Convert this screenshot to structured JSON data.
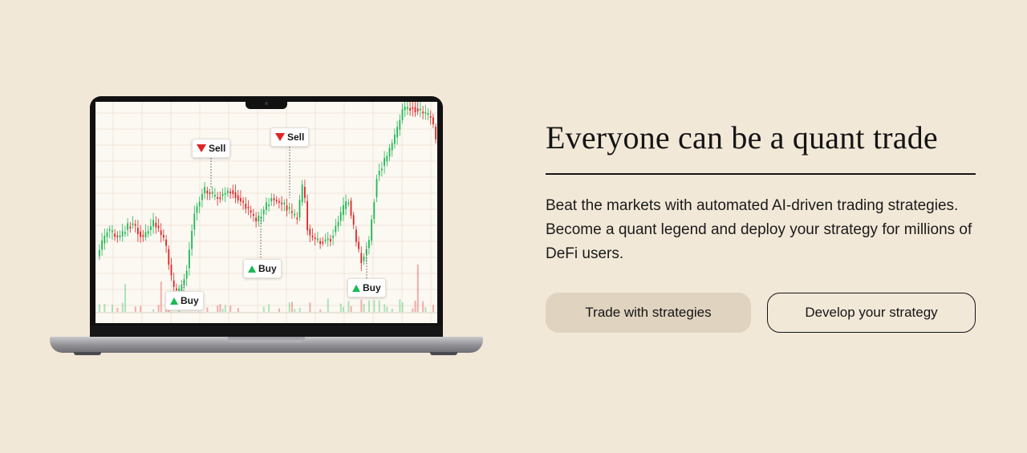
{
  "hero": {
    "title": "Everyone can be a quant trade",
    "description": "Beat the markets with automated AI-driven trading strategies. Become a quant legend and deploy your strategy for millions of DeFi users.",
    "buttons": {
      "primary_label": "Trade with strategies",
      "secondary_label": "Develop your strategy"
    }
  },
  "chart_data": {
    "type": "candlestick",
    "markers": [
      {
        "label": "Sell",
        "direction": "down",
        "color": "#e02424"
      },
      {
        "label": "Sell",
        "direction": "down",
        "color": "#e02424"
      },
      {
        "label": "Buy",
        "direction": "up",
        "color": "#1db954"
      },
      {
        "label": "Buy",
        "direction": "up",
        "color": "#1db954"
      },
      {
        "label": "Buy",
        "direction": "up",
        "color": "#1db954"
      }
    ],
    "colors": {
      "up": "#1db954",
      "down": "#e02424",
      "background": "#fcf8f2",
      "grid": "#efe6da"
    }
  },
  "theme": {
    "background": "#f2e8d8",
    "primary_button": "#e0d4c0",
    "text": "#141414"
  }
}
